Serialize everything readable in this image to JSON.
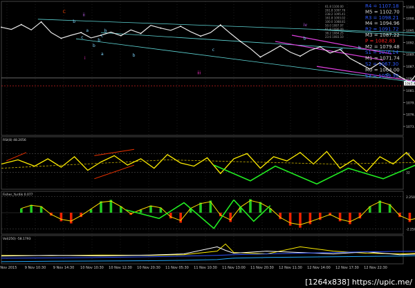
{
  "colors": {
    "background": "#000000",
    "grid": "#3a3a3a",
    "price": "#e8e8e8",
    "channel": "#5fd7d7",
    "magenta": "#e040e0",
    "green_arrow": "#22ee22",
    "rsi": "#ffee00",
    "rsi_ma": "#c9b300",
    "fisher_up": "#22cc22",
    "fisher_down": "#ee2200",
    "fisher_line": "#ffdd00",
    "vol_yellow": "#ffee00",
    "vol_white": "#ffffff",
    "vol_blue": "#3355ff",
    "vol_cyan": "#22aaff",
    "level_blue": "#2f5bff",
    "level_white": "#d8d8d8",
    "level_red": "#ff2020",
    "wave_red": "#ff4400",
    "wave_cyan": "#7fd7ff",
    "wave_purple": "#cc66ff",
    "wave_magenta": "#ff33cc"
  },
  "footer_text": "[1264x838] https://upic.me/",
  "panes": {
    "rsi": {
      "label": "RSI(8) 48.2056",
      "levels": [
        "68",
        "32"
      ]
    },
    "fisher": {
      "label": "Fisher_Yur4ik 0.077",
      "levels": [
        "2.250",
        "-2.250"
      ]
    },
    "vol": {
      "label": "Vol(250) -58.1793"
    }
  },
  "chart_data": [
    {
      "type": "line",
      "name": "price",
      "ylim": [
        1072,
        1101.5
      ],
      "y_ticks": [
        "1100.6",
        "1098.0",
        "1095.3",
        "1092.6",
        "1089.9",
        "1087.2",
        "1084.5",
        "1081.8",
        "1079.1",
        "1076.4",
        "1073.7"
      ],
      "price_tag": "1083.44",
      "x_labels": [
        "9 Nov 2015",
        "9 Nov 10:30",
        "9 Nov 14:30",
        "10 Nov 10:30",
        "10 Nov 12:30",
        "10 Nov 20:30",
        "11 Nov 05:30",
        "11 Nov 10:30",
        "11 Nov 13:00",
        "11 Nov 20:30",
        "12 Nov 11:30",
        "12 Nov 14:00",
        "12 Nov 17:30",
        "12 Nov 22:30"
      ],
      "x": [
        0,
        6,
        12,
        18,
        24,
        30,
        36,
        42,
        48,
        54,
        60,
        66,
        72,
        78,
        84,
        90,
        96,
        102,
        108,
        114,
        120,
        126,
        132,
        138,
        144,
        150,
        156,
        162,
        168,
        174,
        180,
        186,
        192,
        198,
        204,
        210,
        216,
        222,
        228,
        234,
        240,
        246,
        252,
        258,
        264,
        270,
        276,
        282,
        288,
        294,
        300,
        306,
        312,
        318,
        324,
        330,
        336,
        342,
        348
      ],
      "y": [
        1096,
        1095.5,
        1096.6,
        1095.4,
        1097.2,
        1094.8,
        1093.5,
        1094.2,
        1094.8,
        1093.6,
        1094.2,
        1094.9,
        1094.1,
        1095.4,
        1094.6,
        1096.4,
        1095.8,
        1095.3,
        1096.2,
        1095.0,
        1094.0,
        1094.8,
        1096.5,
        1094.6,
        1092.8,
        1091.2,
        1089.3,
        1090.5,
        1091.8,
        1090.4,
        1089.5,
        1090.8,
        1091.6,
        1090.2,
        1091.0,
        1089.0,
        1087.8,
        1086.6,
        1088.0,
        1086.2,
        1084.9,
        1083.6,
        1086.4,
        1088.3,
        1087.9,
        1089.0,
        1088.4,
        1087.6,
        1086.8,
        1085.2,
        1087.0,
        1085.9,
        1084.8,
        1086.3,
        1087.5,
        1085.8,
        1084.6,
        1085.7,
        1083.6
      ]
    },
    {
      "type": "line",
      "name": "wave",
      "x": [
        303,
        306,
        309,
        312,
        316,
        320,
        325,
        332,
        340,
        348,
        356,
        364,
        372,
        382,
        392,
        398
      ],
      "y": [
        1085,
        1082,
        1075.5,
        1077,
        1080.5,
        1084,
        1085.4,
        1083.6,
        1084.8,
        1084.1,
        1083.6,
        1082,
        1077.5,
        1083,
        1090.5,
        1093.5
      ]
    },
    {
      "type": "line",
      "name": "RSI(8)",
      "value": 48.2056,
      "levels": [
        68,
        32
      ],
      "ylim": [
        0,
        100
      ],
      "x": [
        0,
        10,
        20,
        28,
        36,
        44,
        52,
        60,
        68,
        76,
        84,
        92,
        100,
        108,
        116,
        124,
        132,
        140,
        148,
        156,
        164,
        172,
        180,
        188,
        196,
        204,
        212,
        220,
        228,
        236,
        244,
        252,
        260,
        268,
        276,
        284,
        292,
        300,
        308,
        316,
        324,
        332,
        340,
        348,
        356
      ],
      "y": [
        48,
        56,
        44,
        58,
        42,
        62,
        36,
        52,
        64,
        46,
        58,
        40,
        66,
        50,
        44,
        60,
        30,
        58,
        68,
        40,
        62,
        54,
        70,
        48,
        72,
        40,
        56,
        34,
        62,
        48,
        70,
        42,
        66,
        50,
        60,
        36,
        68,
        40,
        28,
        62,
        48,
        72,
        54,
        66,
        44
      ]
    },
    {
      "type": "bar",
      "name": "Fisher_Yur4ik",
      "value": 0.077,
      "levels": [
        2.25,
        -2.25
      ],
      "ylim": [
        -3,
        3
      ],
      "x": [
        12,
        18,
        24,
        30,
        36,
        42,
        48,
        54,
        60,
        66,
        72,
        78,
        84,
        90,
        96,
        102,
        108,
        114,
        120,
        126,
        132,
        138,
        144,
        150,
        156,
        162,
        168,
        174,
        180,
        186,
        192,
        198,
        204,
        210,
        216,
        222,
        228,
        234,
        240,
        246,
        252,
        258,
        264,
        270,
        276,
        282,
        288,
        294,
        300,
        306,
        312,
        318,
        324,
        330,
        336,
        342,
        348
      ],
      "y": [
        0.6,
        1.1,
        0.9,
        -0.4,
        -1.2,
        -1.5,
        -0.6,
        0.5,
        1.6,
        1.8,
        0.9,
        -0.3,
        0.4,
        1.0,
        0.7,
        -0.8,
        -1.4,
        0.6,
        1.4,
        1.7,
        -0.5,
        -1.3,
        0.8,
        1.9,
        1.5,
        0.6,
        -0.9,
        -1.8,
        -2.1,
        -1.6,
        -1.0,
        -0.4,
        -1.2,
        -1.6,
        -0.8,
        0.9,
        1.7,
        1.2,
        -0.6,
        -1.3,
        -0.9,
        0.5,
        1.2,
        1.6,
        -0.5,
        -1.1,
        -1.4,
        -0.8,
        0.6,
        1.0,
        1.4,
        0.8,
        0.3,
        0.9,
        1.1,
        0.4,
        0.1
      ]
    },
    {
      "type": "line",
      "name": "Vol(250)",
      "value": -58.1793,
      "ylim": [
        -100,
        100
      ],
      "x": [
        0,
        30,
        60,
        90,
        110,
        130,
        135,
        140,
        160,
        180,
        200,
        220,
        240,
        260,
        280,
        300,
        320,
        340,
        356
      ],
      "series": [
        {
          "name": "yellow",
          "y": [
            -40,
            -42,
            -38,
            -40,
            -35,
            -10,
            40,
            -20,
            -30,
            20,
            -10,
            -25,
            -30,
            -22,
            -15,
            -20,
            -5,
            -12,
            -8
          ]
        },
        {
          "name": "white",
          "y": [
            -45,
            -40,
            -44,
            -38,
            -30,
            20,
            -5,
            -25,
            -10,
            -20,
            -30,
            -15,
            -35,
            -28,
            -20,
            -25,
            -15,
            -10,
            -5
          ]
        },
        {
          "name": "blue",
          "y": [
            -60,
            -58,
            -55,
            -50,
            -45,
            -40,
            -38,
            -35,
            -30,
            -25,
            -20,
            -15,
            -12,
            -10,
            -8,
            -5,
            -2,
            0,
            2
          ]
        },
        {
          "name": "cyan",
          "y": [
            -85,
            -82,
            -80,
            -78,
            -75,
            -70,
            -65,
            -60,
            -55,
            -52,
            -50,
            -48,
            -45,
            -40,
            -38,
            -35,
            -32,
            -30,
            -28
          ]
        }
      ]
    }
  ],
  "levels_panel": [
    {
      "label": "R4 = 1107.18",
      "color": "#2f5bff"
    },
    {
      "label": "M5 = 1102.70",
      "color": "#d8d8d8"
    },
    {
      "label": "R3 = 1098.21",
      "color": "#2f5bff"
    },
    {
      "label": "M4 = 1094.96",
      "color": "#d8d8d8"
    },
    {
      "label": "R2 = 1091.72",
      "color": "#2f5bff"
    },
    {
      "label": "M3 = 1087.22",
      "color": "#d8d8d8"
    },
    {
      "label": "P = 1082.83",
      "color": "#ff2020"
    },
    {
      "label": "M2 = 1079.48",
      "color": "#d8d8d8"
    },
    {
      "label": "S1 = 1076.14",
      "color": "#2f5bff"
    },
    {
      "label": "M1 = 1071.74",
      "color": "#d8d8d8"
    },
    {
      "label": "S2 = 1067.30",
      "color": "#2f5bff"
    },
    {
      "label": "M0 = 1064.00",
      "color": "#d8d8d8"
    },
    {
      "label": "S3 = 1059.30",
      "color": "#2f5bff"
    }
  ],
  "fib_labels": [
    "61.8 1100.00",
    "261.8 1097.76",
    "238.2 1095.41",
    "161.8 1093.02",
    "100.0 1088.81",
    "50.0 1087.97",
    "61.8 1086.09",
    "38.2 1084.25",
    "23.6 1083.10"
  ],
  "wave_labels": [
    {
      "text": "C",
      "color": "#ff4400"
    },
    {
      "text": "b",
      "color": "#7fd7ff"
    },
    {
      "text": "ii",
      "color": "#cc66ff"
    },
    {
      "text": "c",
      "color": "#7fd7ff"
    },
    {
      "text": "b",
      "color": "#7fd7ff"
    },
    {
      "text": "a",
      "color": "#7fd7ff"
    },
    {
      "text": "b",
      "color": "#7fd7ff"
    },
    {
      "text": "c",
      "color": "#7fd7ff"
    },
    {
      "text": "b",
      "color": "#7fd7ff"
    },
    {
      "text": "i",
      "color": "#ff33cc"
    },
    {
      "text": "a",
      "color": "#7fd7ff"
    },
    {
      "text": "b",
      "color": "#7fd7ff"
    },
    {
      "text": "c",
      "color": "#7fd7ff"
    },
    {
      "text": "iii",
      "color": "#ff33cc"
    },
    {
      "text": "iv",
      "color": "#cc66ff"
    },
    {
      "text": "b",
      "color": "#7fd7ff"
    },
    {
      "text": "a",
      "color": "#7fd7ff"
    },
    {
      "text": "b",
      "color": "#7fd7ff"
    },
    {
      "text": "c",
      "color": "#7fd7ff"
    },
    {
      "text": "v",
      "color": "#cc66ff"
    },
    {
      "text": "c",
      "color": "#7fd7ff"
    }
  ]
}
